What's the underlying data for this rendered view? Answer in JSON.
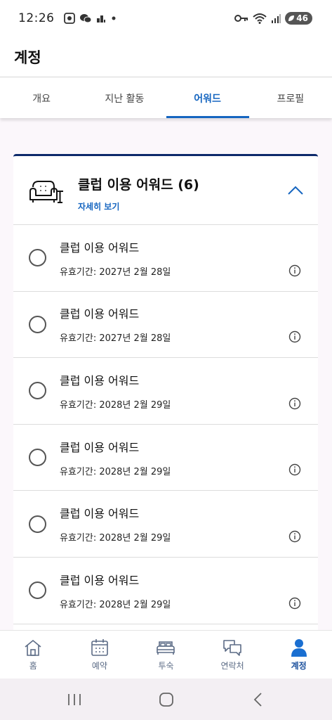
{
  "status_bar": {
    "time": "12:26",
    "battery": "46"
  },
  "header": {
    "title": "계정"
  },
  "tabs": [
    {
      "label": "개요",
      "active": false
    },
    {
      "label": "지난 활동",
      "active": false
    },
    {
      "label": "어워드",
      "active": true
    },
    {
      "label": "프로필",
      "active": false
    }
  ],
  "award_card": {
    "title": "클럽 이용 어워드 (6)",
    "detail_link": "자세히 보기",
    "icon": "armchair-icon",
    "items": [
      {
        "name": "클럽 이용 어워드",
        "validity": "유효기간: 2027년 2월 28일"
      },
      {
        "name": "클럽 이용 어워드",
        "validity": "유효기간: 2027년 2월 28일"
      },
      {
        "name": "클럽 이용 어워드",
        "validity": "유효기간: 2028년 2월 29일"
      },
      {
        "name": "클럽 이용 어워드",
        "validity": "유효기간: 2028년 2월 29일"
      },
      {
        "name": "클럽 이용 어워드",
        "validity": "유효기간: 2028년 2월 29일"
      },
      {
        "name": "클럽 이용 어워드",
        "validity": "유효기간: 2028년 2월 29일"
      }
    ]
  },
  "bottom_nav": [
    {
      "label": "홈",
      "icon": "home-icon",
      "active": false
    },
    {
      "label": "예약",
      "icon": "calendar-icon",
      "active": false
    },
    {
      "label": "투숙",
      "icon": "bed-icon",
      "active": false
    },
    {
      "label": "연락처",
      "icon": "chat-icon",
      "active": false
    },
    {
      "label": "계정",
      "icon": "person-icon",
      "active": true
    }
  ],
  "colors": {
    "accent": "#1565c0",
    "card_border": "#0d2a6b",
    "nav_active": "#1a4f9c",
    "nav_inactive": "#5b6b85"
  }
}
